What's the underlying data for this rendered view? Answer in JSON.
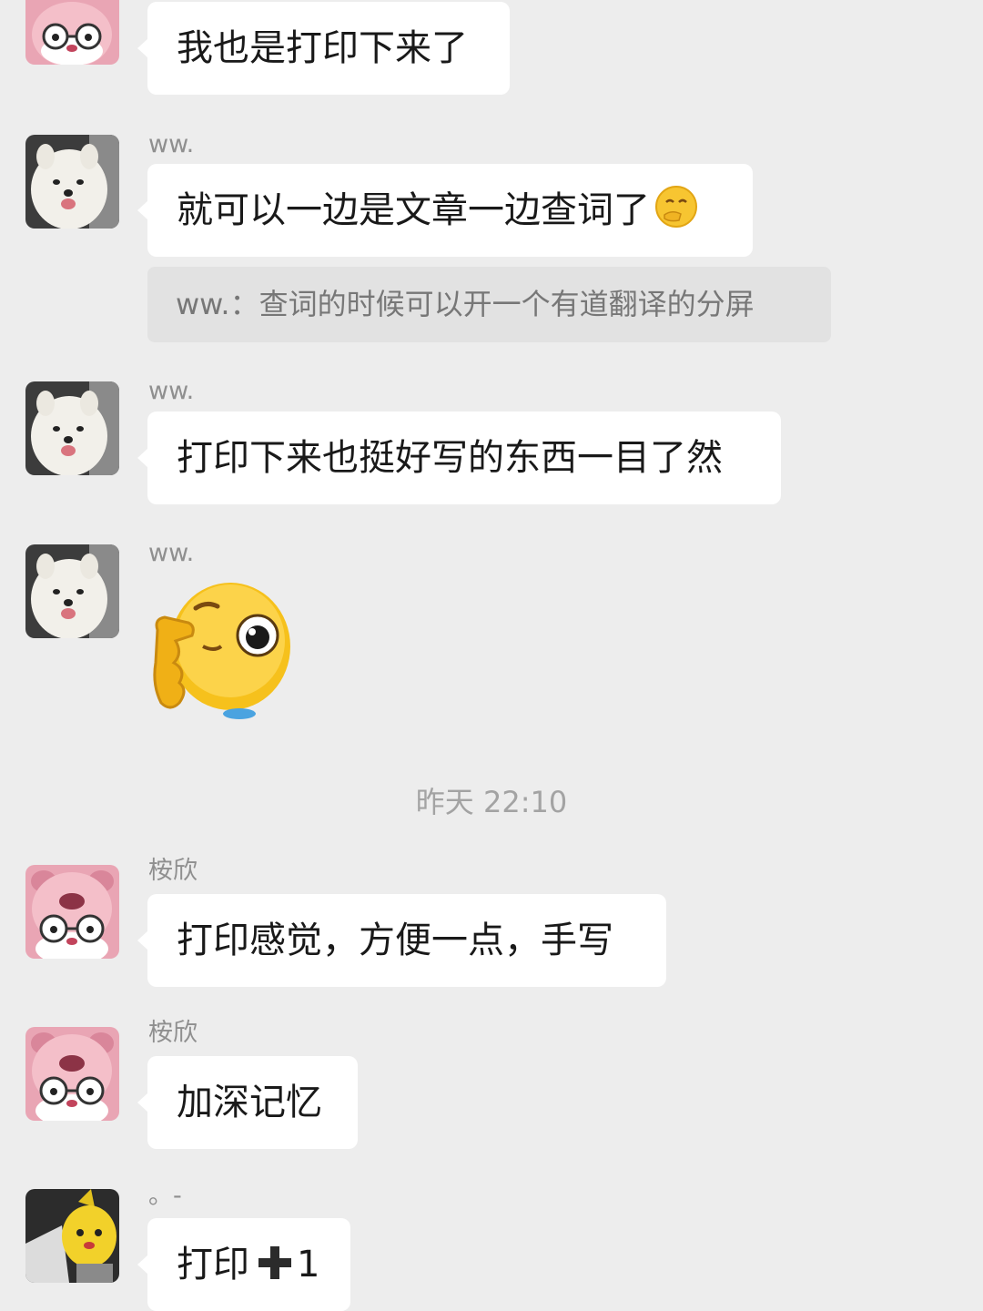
{
  "chat": {
    "messages": [
      {
        "sender": "",
        "text": "我也是打印下来了"
      },
      {
        "sender": "ww.",
        "text": "就可以一边是文章一边查词了",
        "emoji": "thinking-face-emoji"
      },
      {
        "quote": "ww.：查词的时候可以开一个有道翻译的分屏"
      },
      {
        "sender": "ww.",
        "text": "打印下来也挺好写的东西一目了然"
      },
      {
        "sender": "ww.",
        "sticker": "thinking-face-sticker"
      },
      {
        "sender": "桉欣",
        "text": "打印感觉，方便一点，手写"
      },
      {
        "sender": "桉欣",
        "text": "加深记忆"
      },
      {
        "sender": "。-",
        "text_prefix": "打印",
        "icon": "plus-icon",
        "text_suffix": "1"
      }
    ],
    "timestamp": "昨天 22:10"
  },
  "colors": {
    "background": "#ededed",
    "bubble": "#ffffff",
    "quote_bg": "#e2e2e2",
    "sender_text": "#8f8f8f"
  }
}
